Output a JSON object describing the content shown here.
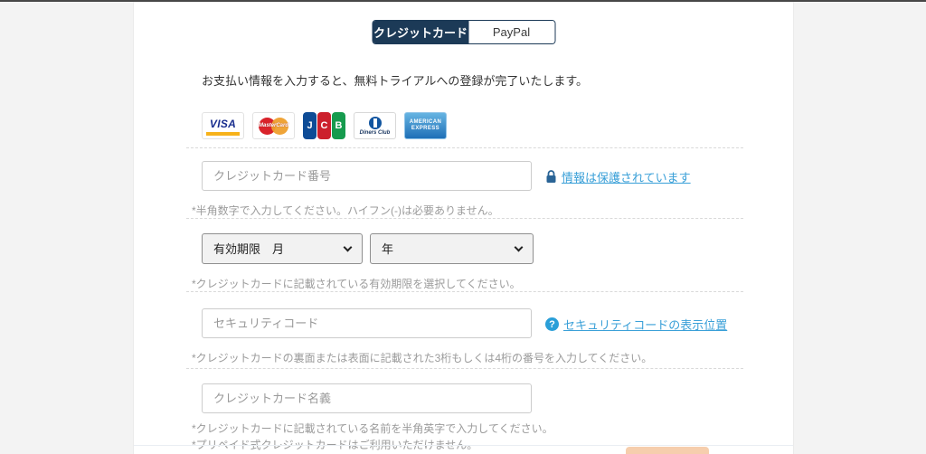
{
  "tabs": {
    "credit_card": "クレジットカード",
    "paypal": "PayPal"
  },
  "intro": "お支払い情報を入力すると、無料トライアルへの登録が完了いたします。",
  "brands": {
    "visa": "VISA",
    "mastercard": "MasterCard",
    "jcb_letters": [
      "J",
      "C",
      "B"
    ],
    "diners": "Diners Club",
    "amex_line1": "AMERICAN",
    "amex_line2": "EXPRESS"
  },
  "card_number": {
    "placeholder": "クレジットカード番号",
    "secure_link": "情報は保護されています",
    "note": "*半角数字で入力してください。ハイフン(-)は必要ありません。"
  },
  "expiry": {
    "month_selected": "有効期限　月",
    "year_selected": "年",
    "note": "*クレジットカードに記載されている有効期限を選択してください。"
  },
  "security_code": {
    "placeholder": "セキュリティコード",
    "help_glyph": "?",
    "help_link": "セキュリティコードの表示位置",
    "note": "*クレジットカードの裏面または表面に記載された3桁もしくは4桁の番号を入力してください。"
  },
  "card_name": {
    "placeholder": "クレジットカード名義",
    "note_name": "*クレジットカードに記載されている名前を半角英字で入力してください。",
    "note_prepaid": "*プリペイド式クレジットカードはご利用いただけません。"
  },
  "colors": {
    "tab_active_bg": "#1c3a57",
    "link_blue": "#3aa0d8",
    "lock_blue": "#2a6496",
    "help_badge_bg": "#2a9fd8",
    "note_gray": "#9b9b9b",
    "accent_orange": "#f3bd92"
  }
}
